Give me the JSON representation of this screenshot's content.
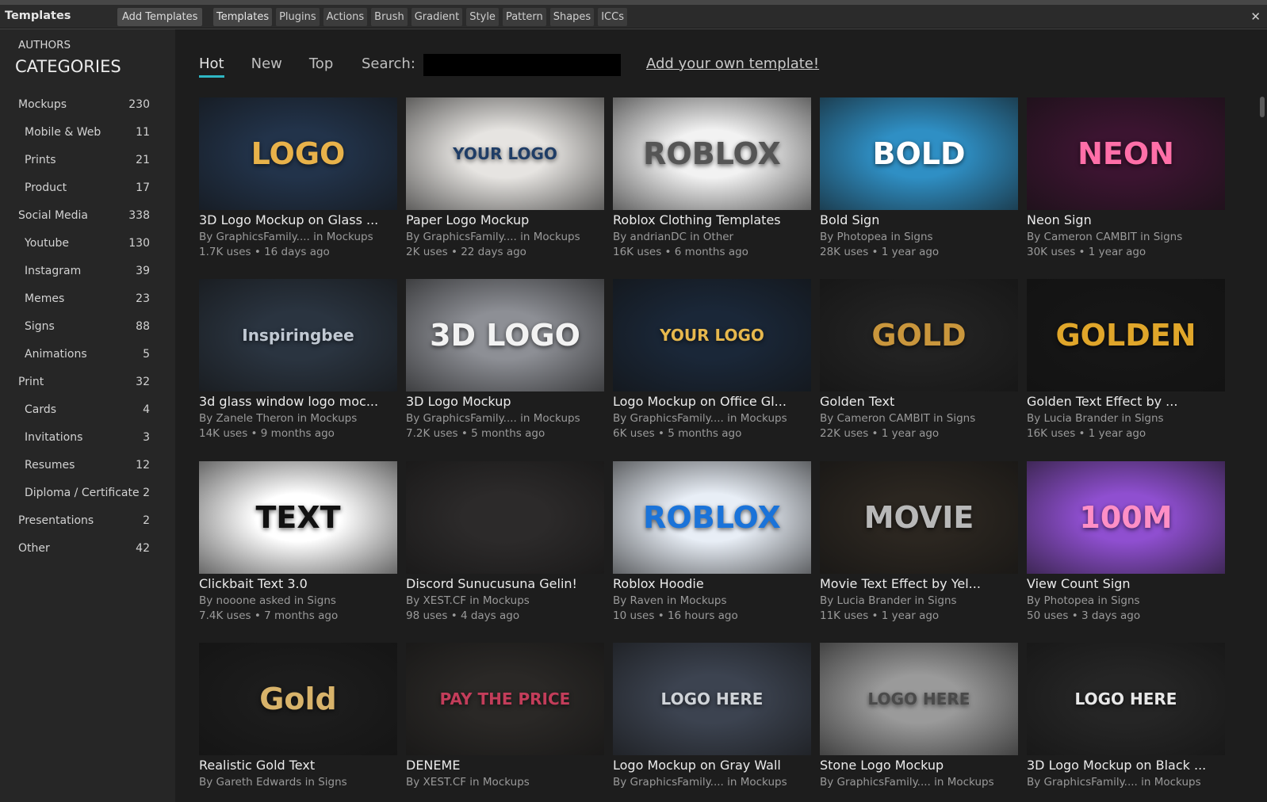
{
  "window": {
    "title": "Templates",
    "close": "✕"
  },
  "toolbar": {
    "add_templates": "Add Templates",
    "tabs": [
      "Templates",
      "Plugins",
      "Actions",
      "Brush",
      "Gradient",
      "Style",
      "Pattern",
      "Shapes",
      "ICCs"
    ]
  },
  "sidebar": {
    "authors": "AUTHORS",
    "categories_title": "CATEGORIES",
    "items": [
      {
        "label": "Mockups",
        "count": "230"
      },
      {
        "label": "Mobile & Web",
        "count": "11"
      },
      {
        "label": "Prints",
        "count": "21"
      },
      {
        "label": "Product",
        "count": "17"
      },
      {
        "label": "Social Media",
        "count": "338"
      },
      {
        "label": "Youtube",
        "count": "130"
      },
      {
        "label": "Instagram",
        "count": "39"
      },
      {
        "label": "Memes",
        "count": "23"
      },
      {
        "label": "Signs",
        "count": "88"
      },
      {
        "label": "Animations",
        "count": "5"
      },
      {
        "label": "Print",
        "count": "32"
      },
      {
        "label": "Cards",
        "count": "4"
      },
      {
        "label": "Invitations",
        "count": "3"
      },
      {
        "label": "Resumes",
        "count": "12"
      },
      {
        "label": "Diploma / Certificate",
        "count": "2"
      },
      {
        "label": "Presentations",
        "count": "2"
      },
      {
        "label": "Other",
        "count": "42"
      }
    ]
  },
  "main": {
    "sort_tabs": [
      "Hot",
      "New",
      "Top"
    ],
    "search_label": "Search:",
    "search_value": "",
    "add_own": "Add your own template!"
  },
  "templates": [
    {
      "title": "3D Logo Mockup on Glass ...",
      "author": "By GraphicsFamily.... in Mockups",
      "stats": "1.7K uses • 16 days ago",
      "thumb_text": "LOGO",
      "thumb_bg": "#22334a",
      "thumb_fg": "#e8b24a"
    },
    {
      "title": "Paper Logo Mockup",
      "author": "By GraphicsFamily.... in Mockups",
      "stats": "2K uses • 22 days ago",
      "thumb_text": "YOUR LOGO",
      "thumb_bg": "#e6e4e1",
      "thumb_fg": "#1f3d66"
    },
    {
      "title": "Roblox Clothing Templates",
      "author": "By andrianDC in Other",
      "stats": "16K uses • 6 months ago",
      "thumb_text": "ROBLOX",
      "thumb_bg": "#f2f2f2",
      "thumb_fg": "#555555"
    },
    {
      "title": "Bold Sign",
      "author": "By Photopea in Signs",
      "stats": "28K uses • 1 year ago",
      "thumb_text": "BOLD",
      "thumb_bg": "#2f8fc4",
      "thumb_fg": "#ffffff"
    },
    {
      "title": "Neon Sign",
      "author": "By Cameron CAMBIT in Signs",
      "stats": "30K uses • 1 year ago",
      "thumb_text": "NEON",
      "thumb_bg": "#3b1430",
      "thumb_fg": "#ff6fa8"
    },
    {
      "title": "3d glass window logo moc...",
      "author": "By Zanele Theron in Mockups",
      "stats": "14K uses • 9 months ago",
      "thumb_text": "Inspiringbee",
      "thumb_bg": "#2a3440",
      "thumb_fg": "#c0c8d2"
    },
    {
      "title": "3D Logo Mockup",
      "author": "By GraphicsFamily.... in Mockups",
      "stats": "7.2K uses • 5 months ago",
      "thumb_text": "3D LOGO",
      "thumb_bg": "#8d8f95",
      "thumb_fg": "#f2f2f2"
    },
    {
      "title": "Logo Mockup on Office Gl...",
      "author": "By GraphicsFamily.... in Mockups",
      "stats": "6K uses • 5 months ago",
      "thumb_text": "YOUR LOGO",
      "thumb_bg": "#1a2738",
      "thumb_fg": "#e6b84d"
    },
    {
      "title": "Golden Text",
      "author": "By Cameron CAMBIT in Signs",
      "stats": "22K uses • 1 year ago",
      "thumb_text": "GOLD",
      "thumb_bg": "#222222",
      "thumb_fg": "#c9963c"
    },
    {
      "title": "Golden Text Effect by ...",
      "author": "By Lucia Brander in Signs",
      "stats": "16K uses • 1 year ago",
      "thumb_text": "GOLDEN",
      "thumb_bg": "#161616",
      "thumb_fg": "#e0a62a"
    },
    {
      "title": "Clickbait Text 3.0",
      "author": "By nooone asked in Signs",
      "stats": "7.4K uses • 7 months ago",
      "thumb_text": "TEXT",
      "thumb_bg": "#ffffff",
      "thumb_fg": "#111111"
    },
    {
      "title": "Discord Sunucusuna Gelin!",
      "author": "By XEST.CF in Mockups",
      "stats": "98 uses • 4 days ago",
      "thumb_text": "",
      "thumb_bg": "#2c2a2a",
      "thumb_fg": "#999999"
    },
    {
      "title": "Roblox Hoodie",
      "author": "By Raven in Mockups",
      "stats": "10 uses • 16 hours ago",
      "thumb_text": "ROBLOX",
      "thumb_bg": "#e8eef6",
      "thumb_fg": "#1a73d9"
    },
    {
      "title": "Movie Text Effect by Yel...",
      "author": "By Lucia Brander in Signs",
      "stats": "11K uses • 1 year ago",
      "thumb_text": "MOVIE",
      "thumb_bg": "#2b2620",
      "thumb_fg": "#b8b8b8"
    },
    {
      "title": "View Count Sign",
      "author": "By Photopea in Signs",
      "stats": "50 uses • 3 days ago",
      "thumb_text": "100M",
      "thumb_bg": "#8f4fd0",
      "thumb_fg": "#ff8fc6"
    },
    {
      "title": "Realistic Gold Text",
      "author": "By Gareth Edwards in Signs",
      "stats": "",
      "thumb_text": "Gold",
      "thumb_bg": "#1c1c1c",
      "thumb_fg": "#d8b36a"
    },
    {
      "title": "DENEME",
      "author": "By XEST.CF in Mockups",
      "stats": "",
      "thumb_text": "PAY THE PRICE",
      "thumb_bg": "#2a2826",
      "thumb_fg": "#c33d5a"
    },
    {
      "title": "Logo Mockup on Gray Wall",
      "author": "By GraphicsFamily.... in Mockups",
      "stats": "",
      "thumb_text": "LOGO HERE",
      "thumb_bg": "#3c4350",
      "thumb_fg": "#cfd3d8"
    },
    {
      "title": "Stone Logo Mockup",
      "author": "By GraphicsFamily.... in Mockups",
      "stats": "",
      "thumb_text": "LOGO HERE",
      "thumb_bg": "#9a9a9a",
      "thumb_fg": "#4a4a4a"
    },
    {
      "title": "3D Logo Mockup on Black ...",
      "author": "By GraphicsFamily.... in Mockups",
      "stats": "",
      "thumb_text": "LOGO HERE",
      "thumb_bg": "#252525",
      "thumb_fg": "#e8e8e8"
    }
  ],
  "colors": {
    "accent": "#2fb7c4",
    "panel": "#262626",
    "main_bg": "#1d1d1d"
  }
}
